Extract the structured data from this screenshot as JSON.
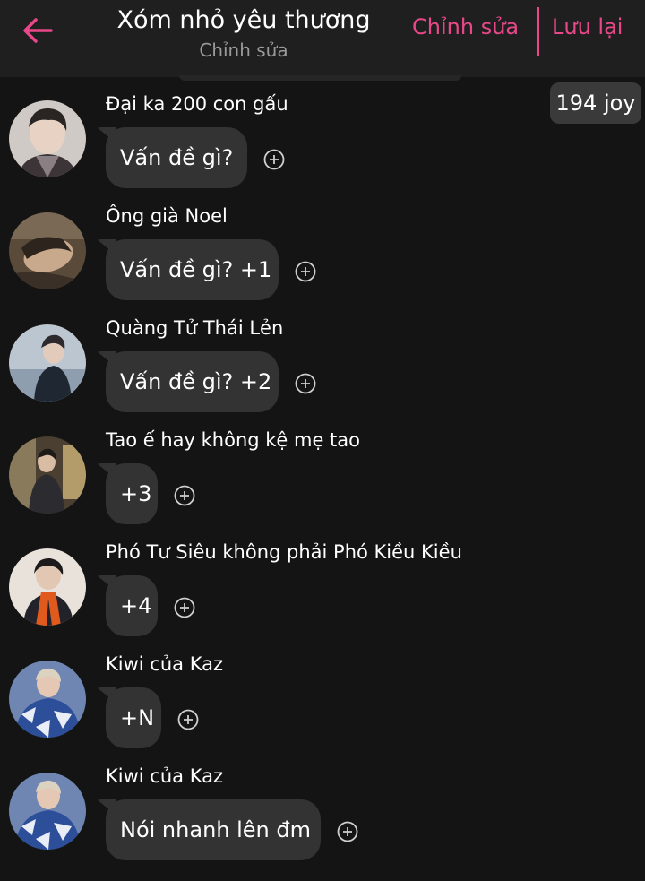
{
  "header": {
    "title": "Xóm nhỏ yêu thương",
    "subtitle": "Chỉnh sửa",
    "edit_label": "Chỉnh sửa",
    "save_label": "Lưu lại",
    "back_icon": "arrow-left-icon",
    "accent_color": "#e8488a"
  },
  "joy_badge": "194 joy",
  "messages": [
    {
      "name": "Đại ka 200 con gấu",
      "text": "Vấn đề gì?"
    },
    {
      "name": "Ông già Noel",
      "text": "Vấn đề gì? +1"
    },
    {
      "name": "Quàng Tử Thái Lẻn",
      "text": "Vấn đề gì? +2"
    },
    {
      "name": "Tao ế hay không kệ mẹ tao",
      "text": "+3"
    },
    {
      "name": "Phó Tư Siêu không phải Phó Kiều Kiều",
      "text": "+4"
    },
    {
      "name": "Kiwi của Kaz",
      "text": "+N"
    },
    {
      "name": "Kiwi của Kaz",
      "text": "Nói nhanh lên đm"
    }
  ]
}
